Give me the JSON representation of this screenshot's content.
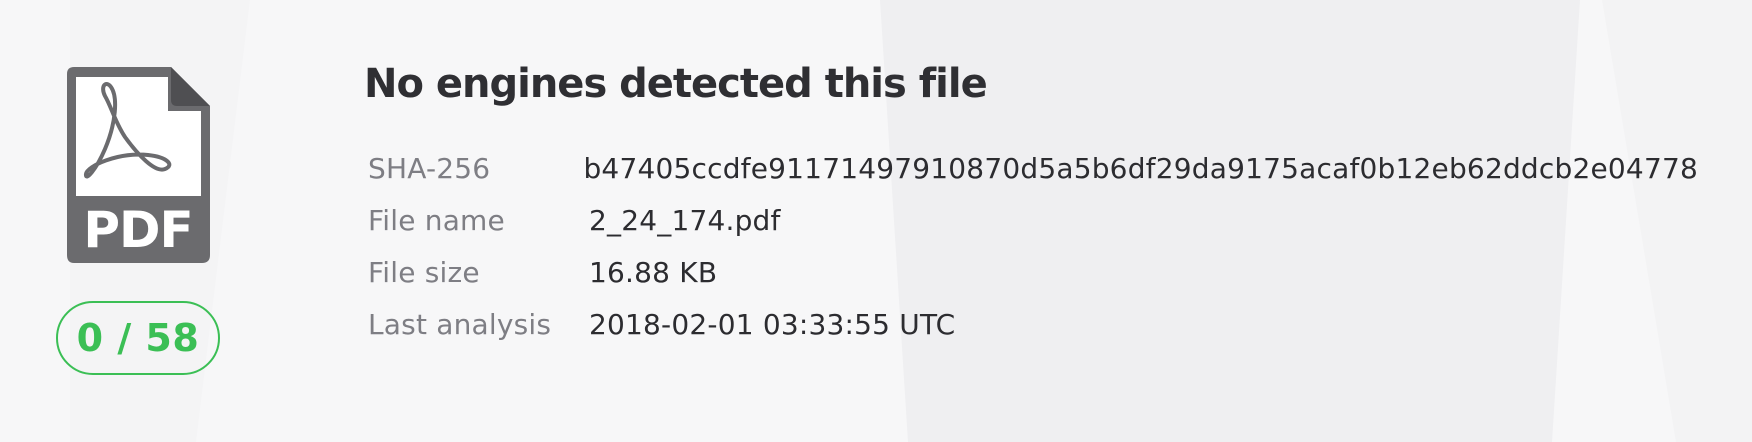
{
  "file": {
    "icon": "pdf-file-icon",
    "type_label": "PDF"
  },
  "score": {
    "text": "0 / 58",
    "detections": 0,
    "engines": 58,
    "color": "#3bbf55"
  },
  "title": "No engines detected this file",
  "details": [
    {
      "label": "SHA-256",
      "value": "b47405ccdfe91171497910870d5a5b6df29da9175acaf0b12eb62ddcb2e04778"
    },
    {
      "label": "File name",
      "value": "2_24_174.pdf"
    },
    {
      "label": "File size",
      "value": "16.88 KB"
    },
    {
      "label": "Last analysis",
      "value": "2018-02-01 03:33:55 UTC"
    }
  ]
}
